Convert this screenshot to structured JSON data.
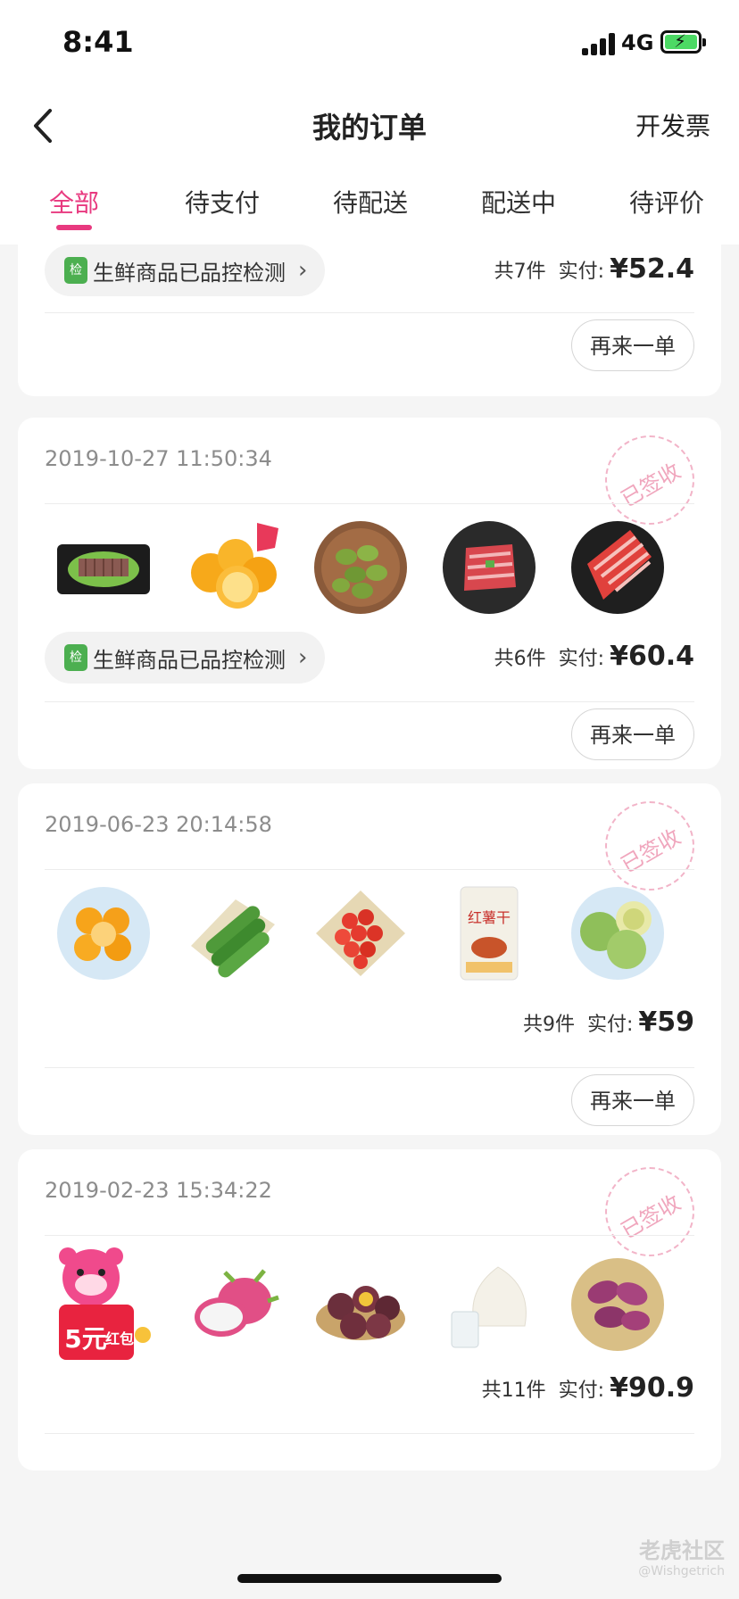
{
  "status_bar": {
    "time": "8:41",
    "network": "4G"
  },
  "nav": {
    "title": "我的订单",
    "invoice_label": "开发票"
  },
  "tabs": [
    {
      "label": "全部",
      "active": true
    },
    {
      "label": "待支付"
    },
    {
      "label": "待配送"
    },
    {
      "label": "配送中"
    },
    {
      "label": "待评价"
    }
  ],
  "orders": [
    {
      "pill_label": "生鲜商品已品控检测",
      "count": "共7件",
      "paid_label": "实付:",
      "amount": "¥52.4",
      "reorder_label": "再来一单"
    },
    {
      "date": "2019-10-27 11:50:34",
      "stamp": "已签收",
      "pill_label": "生鲜商品已品控检测",
      "count": "共6件",
      "paid_label": "实付:",
      "amount": "¥60.4",
      "reorder_label": "再来一单",
      "items": [
        "beef-slices-image",
        "oranges-image",
        "kiwi-berries-image",
        "beef-rolls-image",
        "lamb-rolls-image"
      ]
    },
    {
      "date": "2019-06-23 20:14:58",
      "stamp": "已签收",
      "count": "共9件",
      "paid_label": "实付:",
      "amount": "¥59",
      "reorder_label": "再来一单",
      "items": [
        "mandarins-image",
        "cucumbers-image",
        "cherry-tomatoes-image",
        "dried-sweet-potato-image",
        "melon-image"
      ],
      "snack_brand": "红薯干"
    },
    {
      "date": "2019-02-23 15:34:22",
      "stamp": "已签收",
      "count": "共11件",
      "paid_label": "实付:",
      "amount": "¥90.9",
      "items": [
        "red-packet-bear-image",
        "dragon-fruit-image",
        "passion-fruit-image",
        "coconut-image",
        "purple-sweet-potato-image"
      ],
      "promo": {
        "value": "5元",
        "text": "红包"
      }
    }
  ],
  "watermark": {
    "line1": "老虎社区",
    "line2": "@Wishgetrich"
  },
  "colors": {
    "accent": "#e8397f",
    "stamp": "#f0a6bd",
    "shield": "#4caf50"
  }
}
